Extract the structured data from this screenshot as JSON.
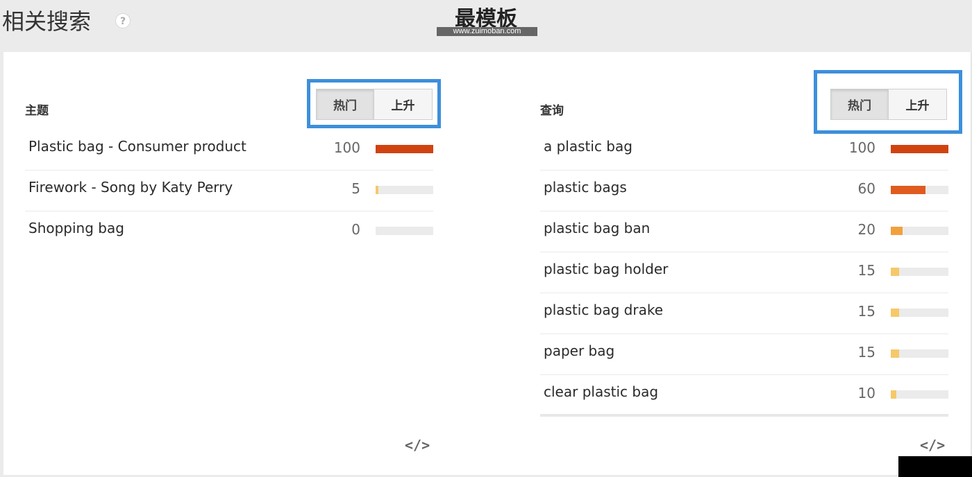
{
  "header": {
    "title": "相关搜索",
    "help_icon": "?",
    "watermark_title": "最模板",
    "watermark_url": "www.zuimoban.com"
  },
  "topics": {
    "title": "主题",
    "tabs": [
      "热门",
      "上升"
    ],
    "active_tab": 0,
    "items": [
      {
        "label": "Plastic bag - Consumer product",
        "value": "100",
        "fill": 1.0,
        "color": "#d14211"
      },
      {
        "label": "Firework - Song by Katy Perry",
        "value": "5",
        "fill": 0.05,
        "color": "#f6c86a"
      },
      {
        "label": "Shopping bag",
        "value": "0",
        "fill": 0.0,
        "color": "#f6c86a"
      }
    ],
    "embed_icon": "</>"
  },
  "queries": {
    "title": "查询",
    "tabs": [
      "热门",
      "上升"
    ],
    "active_tab": 0,
    "items": [
      {
        "label": "a plastic bag",
        "value": "100",
        "fill": 1.0,
        "color": "#d14211"
      },
      {
        "label": "plastic bags",
        "value": "60",
        "fill": 0.6,
        "color": "#e05b1f"
      },
      {
        "label": "plastic bag ban",
        "value": "20",
        "fill": 0.2,
        "color": "#f2a03e"
      },
      {
        "label": "plastic bag holder",
        "value": "15",
        "fill": 0.15,
        "color": "#f6c86a"
      },
      {
        "label": "plastic bag drake",
        "value": "15",
        "fill": 0.15,
        "color": "#f6c86a"
      },
      {
        "label": "paper bag",
        "value": "15",
        "fill": 0.15,
        "color": "#f6c86a"
      },
      {
        "label": "clear plastic bag",
        "value": "10",
        "fill": 0.1,
        "color": "#f6c86a"
      }
    ],
    "embed_icon": "</>"
  },
  "colors": {
    "highlight": "#3d8fdb",
    "bar_bg": "#ebebeb"
  }
}
